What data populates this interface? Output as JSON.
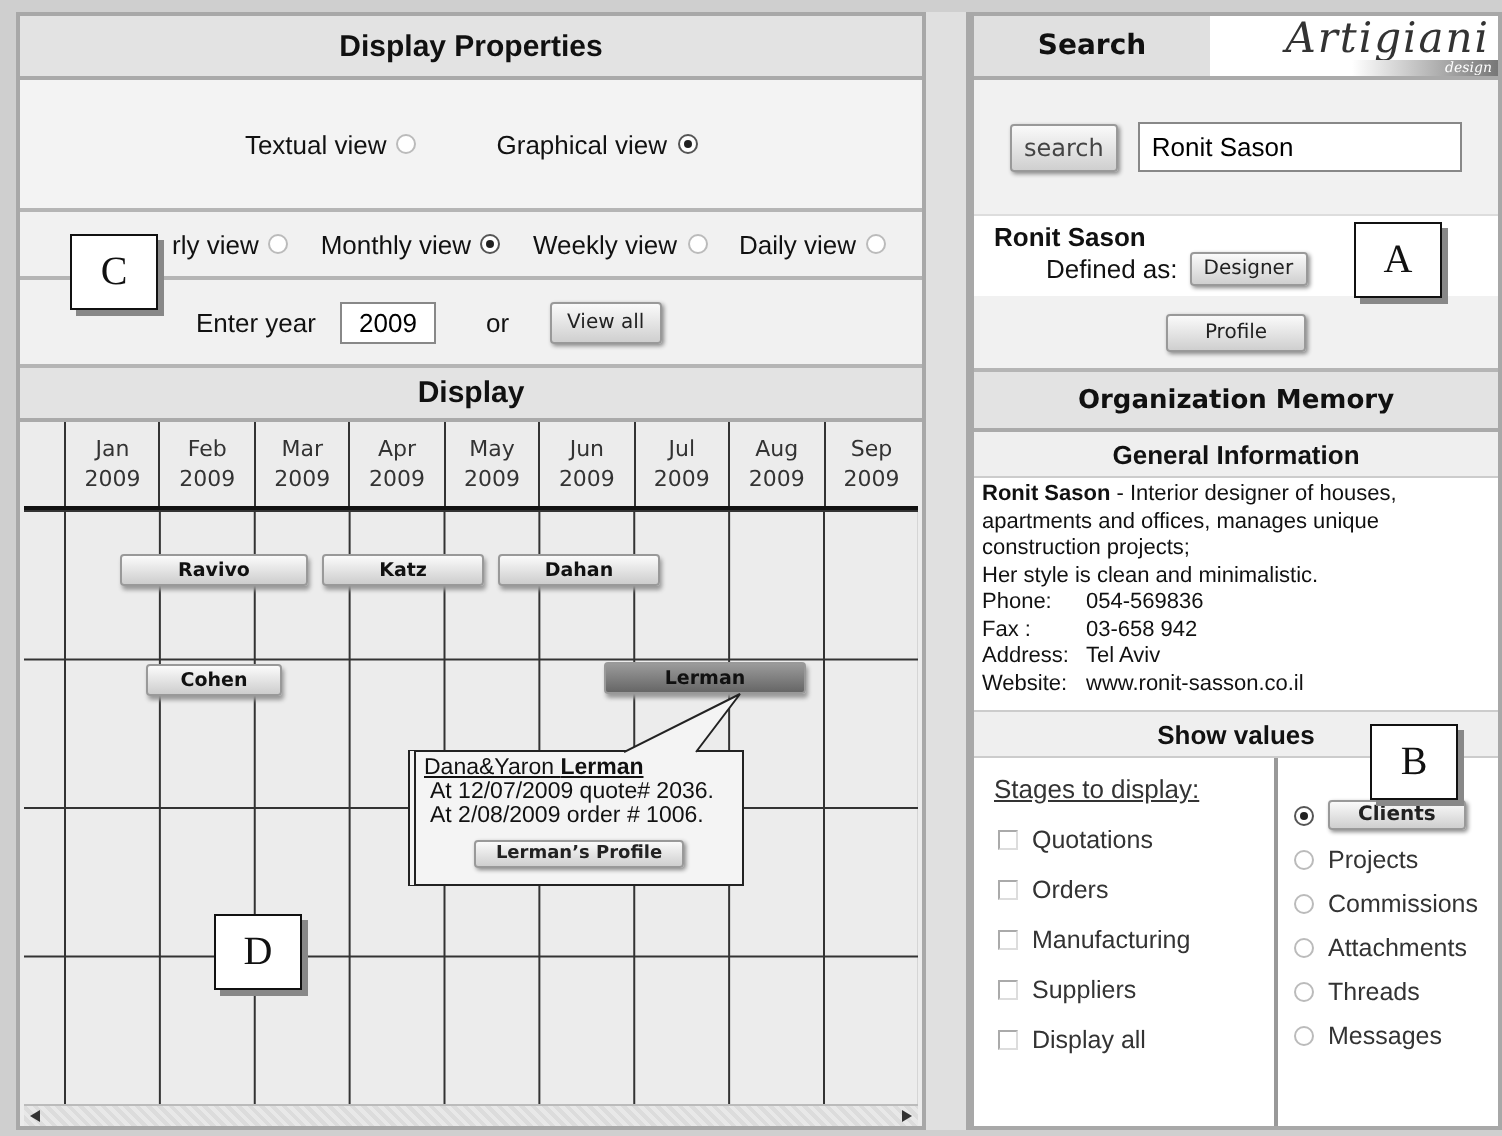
{
  "display_properties": {
    "title": "Display Properties",
    "view_modes": [
      {
        "label": "Textual view",
        "selected": false
      },
      {
        "label": "Graphical view",
        "selected": true
      }
    ],
    "periods": [
      {
        "label": "rly view",
        "selected": false
      },
      {
        "label": "Monthly view",
        "selected": true
      },
      {
        "label": "Weekly view",
        "selected": false
      },
      {
        "label": "Daily view",
        "selected": false
      }
    ],
    "year_label": "Enter year",
    "year": "2009",
    "or_label": "or",
    "view_all_button": "View all",
    "callout": "C"
  },
  "display": {
    "title": "Display",
    "months": [
      {
        "month": "Jan",
        "year": "2009"
      },
      {
        "month": "Feb",
        "year": "2009"
      },
      {
        "month": "Mar",
        "year": "2009"
      },
      {
        "month": "Apr",
        "year": "2009"
      },
      {
        "month": "May",
        "year": "2009"
      },
      {
        "month": "Jun",
        "year": "2009"
      },
      {
        "month": "Jul",
        "year": "2009"
      },
      {
        "month": "Aug",
        "year": "2009"
      },
      {
        "month": "Sep",
        "year": "2009"
      }
    ],
    "bars": [
      {
        "label": "Ravivo",
        "selected": false
      },
      {
        "label": "Katz",
        "selected": false
      },
      {
        "label": "Dahan",
        "selected": false
      },
      {
        "label": "Cohen",
        "selected": false
      },
      {
        "label": "Lerman",
        "selected": true
      }
    ],
    "tooltip": {
      "name_prefix": "Dana&Yaron",
      "name": "Lerman",
      "lines": [
        "At 12/07/2009 quote# 2036.",
        "At 2/08/2009 order # 1006."
      ],
      "button": "Lerman’s Profile"
    },
    "callout": "D"
  },
  "search": {
    "title": "Search",
    "logo": "Artigiani",
    "logo_sub": "design",
    "button": "search",
    "value": "Ronit Sason"
  },
  "person": {
    "name": "Ronit Sason",
    "defined_label": "Defined as:",
    "role_button": "Designer",
    "profile_button": "Profile",
    "callout": "A"
  },
  "organization_memory": {
    "title": "Organization Memory",
    "general_title": "General Information",
    "description": "**Ronit Sason** - Interior designer of houses, apartments and offices, manages unique construction projects;",
    "style_line": "Her style is clean and minimalistic.",
    "contacts": [
      {
        "label": "Phone:",
        "value": "054-569836"
      },
      {
        "label": "Fax :",
        "value": "03-658 942"
      },
      {
        "label": "Address:",
        "value": "Tel Aviv"
      },
      {
        "label": "Website:",
        "value": "www.ronit-sasson.co.il"
      }
    ]
  },
  "show_values": {
    "title": "Show values",
    "stages_title": "Stages to display:",
    "stages": [
      {
        "label": "Quotations",
        "checked": false
      },
      {
        "label": "Orders",
        "checked": false
      },
      {
        "label": "Manufacturing",
        "checked": false
      },
      {
        "label": "Suppliers",
        "checked": false
      },
      {
        "label": "Display all",
        "checked": false
      }
    ],
    "values": [
      {
        "label": "Clients",
        "selected": true
      },
      {
        "label": "Projects",
        "selected": false
      },
      {
        "label": "Commissions",
        "selected": false
      },
      {
        "label": "Attachments",
        "selected": false
      },
      {
        "label": "Threads",
        "selected": false
      },
      {
        "label": "Messages",
        "selected": false
      }
    ],
    "callout": "B"
  }
}
